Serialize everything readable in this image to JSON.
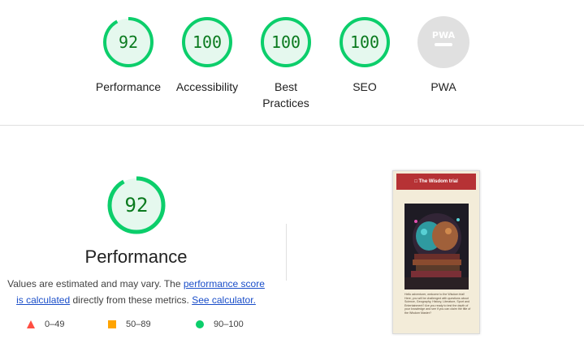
{
  "colors": {
    "pass": "#0cce6b",
    "pass_fill": "#e5f8ee",
    "pass_text": "#0a7a1e",
    "average": "#ffa400",
    "fail": "#ff4e42",
    "pwa_gray": "#e0e0e0"
  },
  "gauges": [
    {
      "label": "Performance",
      "score": 92
    },
    {
      "label": "Accessibility",
      "score": 100
    },
    {
      "label": "Best Practices",
      "score": 100
    },
    {
      "label": "SEO",
      "score": 100
    },
    {
      "label": "PWA",
      "badge_text": "PWA",
      "icon": "pwa-badge-icon"
    }
  ],
  "performance": {
    "score": 92,
    "title": "Performance",
    "desc_prefix": "Values are estimated and may vary. The ",
    "link_score": "performance score is calculated",
    "desc_middle": " directly from these metrics. ",
    "link_calc": "See calculator."
  },
  "legend": [
    {
      "range": "0–49",
      "icon": "triangle-icon"
    },
    {
      "range": "50–89",
      "icon": "square-icon"
    },
    {
      "range": "90–100",
      "icon": "circle-icon"
    }
  ],
  "screenshot": {
    "header": "The Wisdom trial",
    "text": "Hello adventurer, welcome to the Wisdom trial! Here, you will be challenged with questions about Science, Geography, History, Literature, Sport and Entertainment? Are you ready to test the depth of your knowledge and see if you can claim the title of the Wisdom Master?"
  }
}
